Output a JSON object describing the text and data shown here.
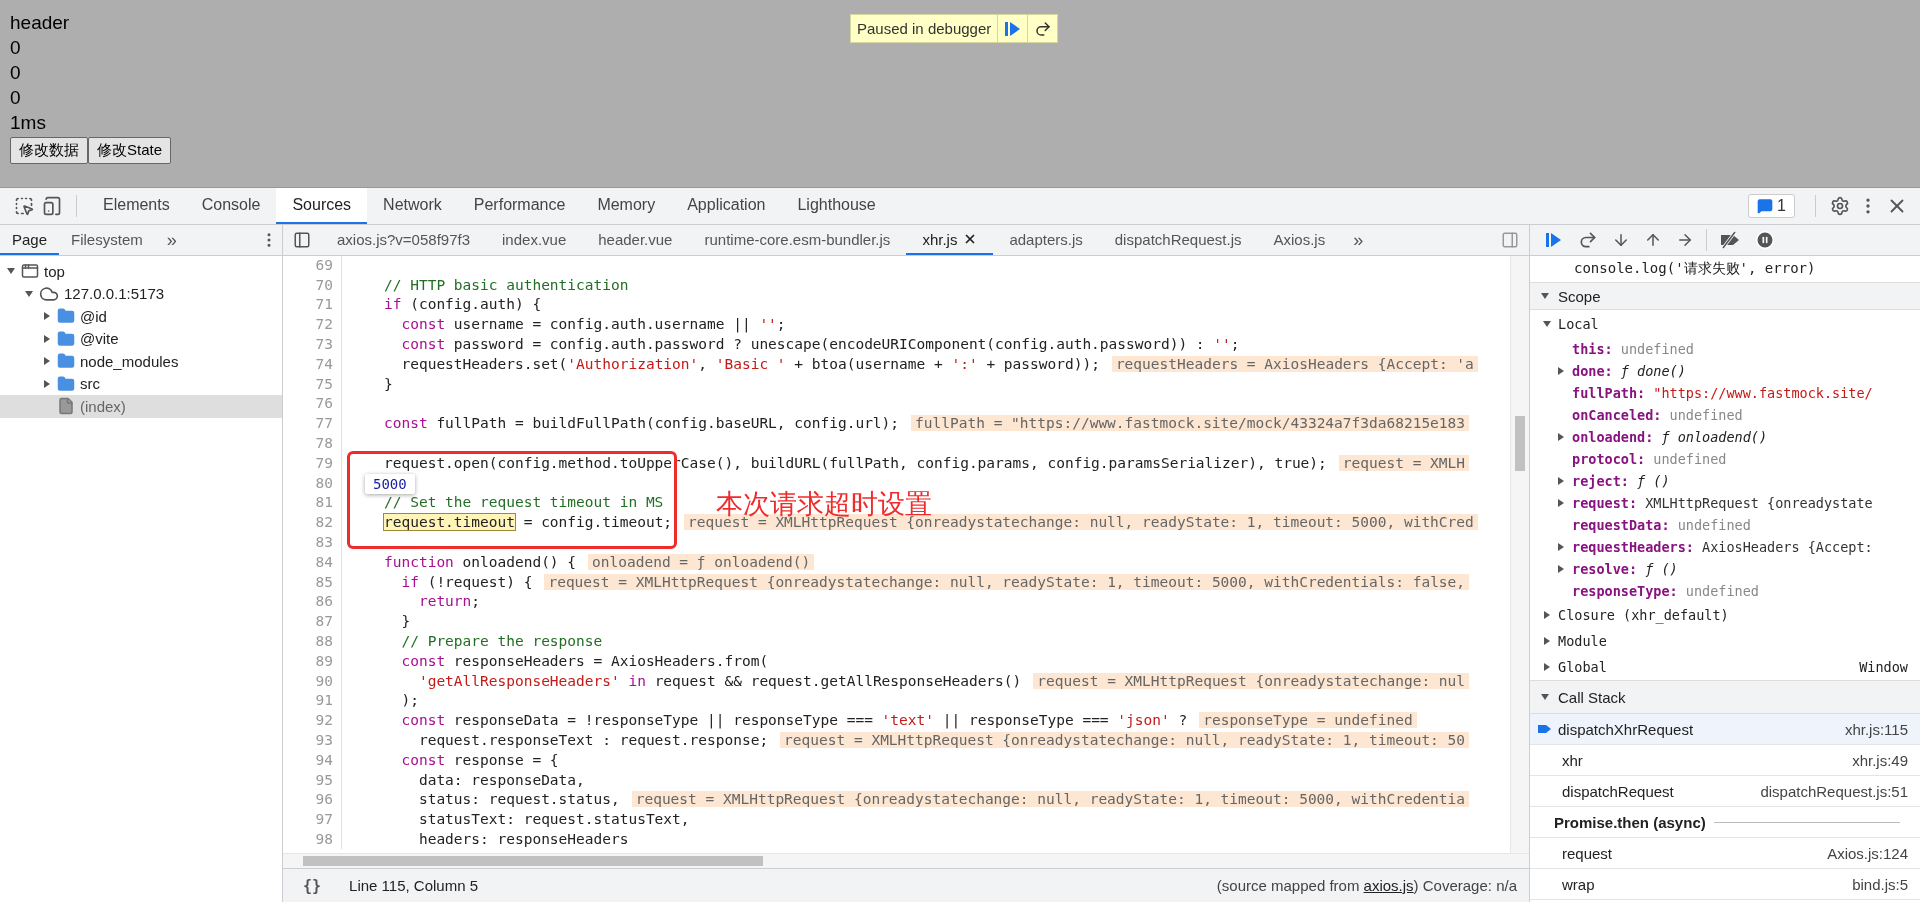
{
  "page": {
    "lines": [
      "header",
      "0",
      "0",
      "0",
      "1ms"
    ],
    "buttons": [
      "修改数据",
      "修改State"
    ],
    "paused_banner": {
      "label": "Paused in debugger"
    }
  },
  "devtools": {
    "tabs": [
      {
        "label": "Elements",
        "selected": false
      },
      {
        "label": "Console",
        "selected": false
      },
      {
        "label": "Sources",
        "selected": true
      },
      {
        "label": "Network",
        "selected": false
      },
      {
        "label": "Performance",
        "selected": false
      },
      {
        "label": "Memory",
        "selected": false
      },
      {
        "label": "Application",
        "selected": false
      },
      {
        "label": "Lighthouse",
        "selected": false
      }
    ],
    "issues_count": "1",
    "navigator": {
      "tabs": [
        {
          "label": "Page",
          "selected": true
        },
        {
          "label": "Filesystem",
          "selected": false
        }
      ],
      "more": "»",
      "tree": [
        {
          "label": "top",
          "kind": "frame",
          "expanded": true,
          "selected": false,
          "children": [
            {
              "label": "127.0.0.1:5173",
              "kind": "origin",
              "expanded": true,
              "selected": false,
              "children": [
                {
                  "label": "@id",
                  "kind": "folder",
                  "expanded": false,
                  "selected": false
                },
                {
                  "label": "@vite",
                  "kind": "folder",
                  "expanded": false,
                  "selected": false
                },
                {
                  "label": "node_modules",
                  "kind": "folder",
                  "expanded": false,
                  "selected": false
                },
                {
                  "label": "src",
                  "kind": "folder",
                  "expanded": false,
                  "selected": false
                },
                {
                  "label": "(index)",
                  "kind": "file",
                  "selected": true
                }
              ]
            }
          ]
        }
      ]
    },
    "editor_tabs": [
      {
        "label": "axios.js?v=058f97f3",
        "selected": false,
        "closable": false
      },
      {
        "label": "index.vue",
        "selected": false,
        "closable": false
      },
      {
        "label": "header.vue",
        "selected": false,
        "closable": false
      },
      {
        "label": "runtime-core.esm-bundler.js",
        "selected": false,
        "closable": false
      },
      {
        "label": "xhr.js",
        "selected": true,
        "closable": true
      },
      {
        "label": "adapters.js",
        "selected": false,
        "closable": false
      },
      {
        "label": "dispatchRequest.js",
        "selected": false,
        "closable": false
      },
      {
        "label": "Axios.js",
        "selected": false,
        "closable": false
      }
    ],
    "editor_more": "»",
    "code_lines": [
      {
        "number": "69"
      },
      {
        "number": "70",
        "tokens": [
          {
            "kind": "comment",
            "text": "// HTTP basic authentication"
          }
        ]
      },
      {
        "number": "71",
        "tokens": [
          {
            "kind": "keyword",
            "text": "if"
          },
          {
            "kind": "plain",
            "text": " (config.auth) {"
          }
        ]
      },
      {
        "number": "72",
        "tokens": [
          {
            "kind": "keyword",
            "text": "  const"
          },
          {
            "kind": "plain",
            "text": " username = config.auth.username || "
          },
          {
            "kind": "string",
            "text": "''"
          },
          {
            "kind": "plain",
            "text": ";"
          }
        ]
      },
      {
        "number": "73",
        "tokens": [
          {
            "kind": "keyword",
            "text": "  const"
          },
          {
            "kind": "plain",
            "text": " password = config.auth.password ? unescape(encodeURIComponent(config.auth.password)) : "
          },
          {
            "kind": "string",
            "text": "''"
          },
          {
            "kind": "plain",
            "text": ";"
          }
        ]
      },
      {
        "number": "74",
        "tokens": [
          {
            "kind": "plain",
            "text": "  requestHeaders.set("
          },
          {
            "kind": "string",
            "text": "'Authorization'"
          },
          {
            "kind": "plain",
            "text": ", "
          },
          {
            "kind": "string",
            "text": "'Basic '"
          },
          {
            "kind": "plain",
            "text": " + btoa(username + "
          },
          {
            "kind": "string",
            "text": "':'"
          },
          {
            "kind": "plain",
            "text": " + password));"
          }
        ],
        "inline_value": "requestHeaders = AxiosHeaders {Accept: 'a"
      },
      {
        "number": "75",
        "tokens": [
          {
            "kind": "plain",
            "text": "}"
          }
        ]
      },
      {
        "number": "76"
      },
      {
        "number": "77",
        "tokens": [
          {
            "kind": "keyword",
            "text": "const"
          },
          {
            "kind": "plain",
            "text": " fullPath = buildFullPath(config.baseURL, config.url);"
          }
        ],
        "inline_value": "fullPath = \"https://www.fastmock.site/mock/43324a7f3da68215e183"
      },
      {
        "number": "78"
      },
      {
        "number": "79",
        "tokens": [
          {
            "kind": "plain",
            "text": "request.open(config.method.toUpperCase(), buildURL(fullPath, config.params, config.paramsSerializer), true);"
          }
        ],
        "inline_value": "request = XMLH"
      },
      {
        "number": "80"
      },
      {
        "number": "81",
        "tokens": [
          {
            "kind": "comment",
            "text": "// Set the request timeout in MS"
          }
        ]
      },
      {
        "number": "82",
        "tokens": [
          {
            "kind": "hover",
            "text": "request.timeout"
          },
          {
            "kind": "plain",
            "text": " = config.timeout;"
          }
        ],
        "inline_value": "request = XMLHttpRequest {onreadystatechange: null, readyState: 1, timeout: 5000, withCred"
      },
      {
        "number": "83"
      },
      {
        "number": "84",
        "tokens": [
          {
            "kind": "keyword",
            "text": "function"
          },
          {
            "kind": "plain",
            "text": " onloadend() {"
          }
        ],
        "inline_value": "onloadend = ƒ onloadend()"
      },
      {
        "number": "85",
        "tokens": [
          {
            "kind": "keyword",
            "text": "  if"
          },
          {
            "kind": "plain",
            "text": " (!request) {"
          }
        ],
        "inline_value": "request = XMLHttpRequest {onreadystatechange: null, readyState: 1, timeout: 5000, withCredentials: false,"
      },
      {
        "number": "86",
        "tokens": [
          {
            "kind": "keyword",
            "text": "    return"
          },
          {
            "kind": "plain",
            "text": ";"
          }
        ]
      },
      {
        "number": "87",
        "tokens": [
          {
            "kind": "plain",
            "text": "  }"
          }
        ]
      },
      {
        "number": "88",
        "tokens": [
          {
            "kind": "comment",
            "text": "  // Prepare the response"
          }
        ]
      },
      {
        "number": "89",
        "tokens": [
          {
            "kind": "keyword",
            "text": "  const"
          },
          {
            "kind": "plain",
            "text": " responseHeaders = AxiosHeaders.from("
          }
        ]
      },
      {
        "number": "90",
        "tokens": [
          {
            "kind": "string",
            "text": "    'getAllResponseHeaders'"
          },
          {
            "kind": "keyword",
            "text": " in"
          },
          {
            "kind": "plain",
            "text": " request && request.getAllResponseHeaders()"
          }
        ],
        "inline_value": "request = XMLHttpRequest {onreadystatechange: nul"
      },
      {
        "number": "91",
        "tokens": [
          {
            "kind": "plain",
            "text": "  );"
          }
        ]
      },
      {
        "number": "92",
        "tokens": [
          {
            "kind": "keyword",
            "text": "  const"
          },
          {
            "kind": "plain",
            "text": " responseData = !responseType || responseType === "
          },
          {
            "kind": "string",
            "text": "'text'"
          },
          {
            "kind": "plain",
            "text": " || responseType === "
          },
          {
            "kind": "string",
            "text": "'json'"
          },
          {
            "kind": "plain",
            "text": " ?"
          }
        ],
        "inline_value": "responseType = undefined"
      },
      {
        "number": "93",
        "tokens": [
          {
            "kind": "plain",
            "text": "    request.responseText : request.response;"
          }
        ],
        "inline_value": "request = XMLHttpRequest {onreadystatechange: null, readyState: 1, timeout: 50"
      },
      {
        "number": "94",
        "tokens": [
          {
            "kind": "keyword",
            "text": "  const"
          },
          {
            "kind": "plain",
            "text": " response = {"
          }
        ]
      },
      {
        "number": "95",
        "tokens": [
          {
            "kind": "plain",
            "text": "    data: responseData,"
          }
        ]
      },
      {
        "number": "96",
        "tokens": [
          {
            "kind": "plain",
            "text": "    status: request.status,"
          }
        ],
        "inline_value": "request = XMLHttpRequest {onreadystatechange: null, readyState: 1, timeout: 5000, withCredentia"
      },
      {
        "number": "97",
        "tokens": [
          {
            "kind": "plain",
            "text": "    statusText: request.statusText,"
          }
        ]
      },
      {
        "number": "98",
        "tokens": [
          {
            "kind": "plain",
            "text": "    headers: responseHeaders"
          }
        ]
      }
    ],
    "value_tooltip": "5000",
    "annotation": "本次请求超时设置",
    "status": {
      "pretty_print": "{}",
      "position": "Line 115, Column 5",
      "source_prefix": "(source mapped from ",
      "source_link": "axios.js",
      "source_suffix": ")",
      "coverage": "Coverage: n/a"
    },
    "debugger": {
      "breakpoint_preview": "console.log('请求失败', error)",
      "scope": {
        "title": "Scope",
        "expanded": true,
        "groups": [
          {
            "label": "Local",
            "expanded": true,
            "items": [
              {
                "name": "this:",
                "value": "undefined",
                "kind": "undefined",
                "expandable": false
              },
              {
                "name": "done:",
                "value": "ƒ done()",
                "kind": "function",
                "expandable": true
              },
              {
                "name": "fullPath:",
                "value": "\"https://www.fastmock.site/",
                "kind": "string",
                "expandable": false
              },
              {
                "name": "onCanceled:",
                "value": "undefined",
                "kind": "undefined",
                "expandable": false
              },
              {
                "name": "onloadend:",
                "value": "ƒ onloadend()",
                "kind": "function",
                "expandable": true
              },
              {
                "name": "protocol:",
                "value": "undefined",
                "kind": "undefined",
                "expandable": false
              },
              {
                "name": "reject:",
                "value": "ƒ ()",
                "kind": "function",
                "expandable": true
              },
              {
                "name": "request:",
                "value": "XMLHttpRequest {onreadystate",
                "kind": "object",
                "expandable": true
              },
              {
                "name": "requestData:",
                "value": "undefined",
                "kind": "undefined",
                "expandable": false
              },
              {
                "name": "requestHeaders:",
                "value": "AxiosHeaders {Accept:",
                "kind": "object",
                "expandable": true
              },
              {
                "name": "resolve:",
                "value": "ƒ ()",
                "kind": "function",
                "expandable": true
              },
              {
                "name": "responseType:",
                "value": "undefined",
                "kind": "undefined",
                "expandable": false
              }
            ]
          },
          {
            "label": "Closure (xhr_default)",
            "expanded": false
          },
          {
            "label": "Module",
            "expanded": false
          },
          {
            "label": "Global",
            "expanded": false,
            "value": "Window"
          }
        ]
      },
      "call_stack": {
        "title": "Call Stack",
        "expanded": true,
        "frames": [
          {
            "kind": "frame",
            "name": "dispatchXhrRequest",
            "location": "xhr.js:115",
            "selected": true
          },
          {
            "kind": "frame",
            "name": "xhr",
            "location": "xhr.js:49",
            "selected": false
          },
          {
            "kind": "frame",
            "name": "dispatchRequest",
            "location": "dispatchRequest.js:51",
            "selected": false
          },
          {
            "kind": "async",
            "name": "Promise.then (async)"
          },
          {
            "kind": "frame",
            "name": "request",
            "location": "Axios.js:124",
            "selected": false
          },
          {
            "kind": "frame",
            "name": "wrap",
            "location": "bind.js:5",
            "selected": false
          }
        ]
      }
    }
  }
}
